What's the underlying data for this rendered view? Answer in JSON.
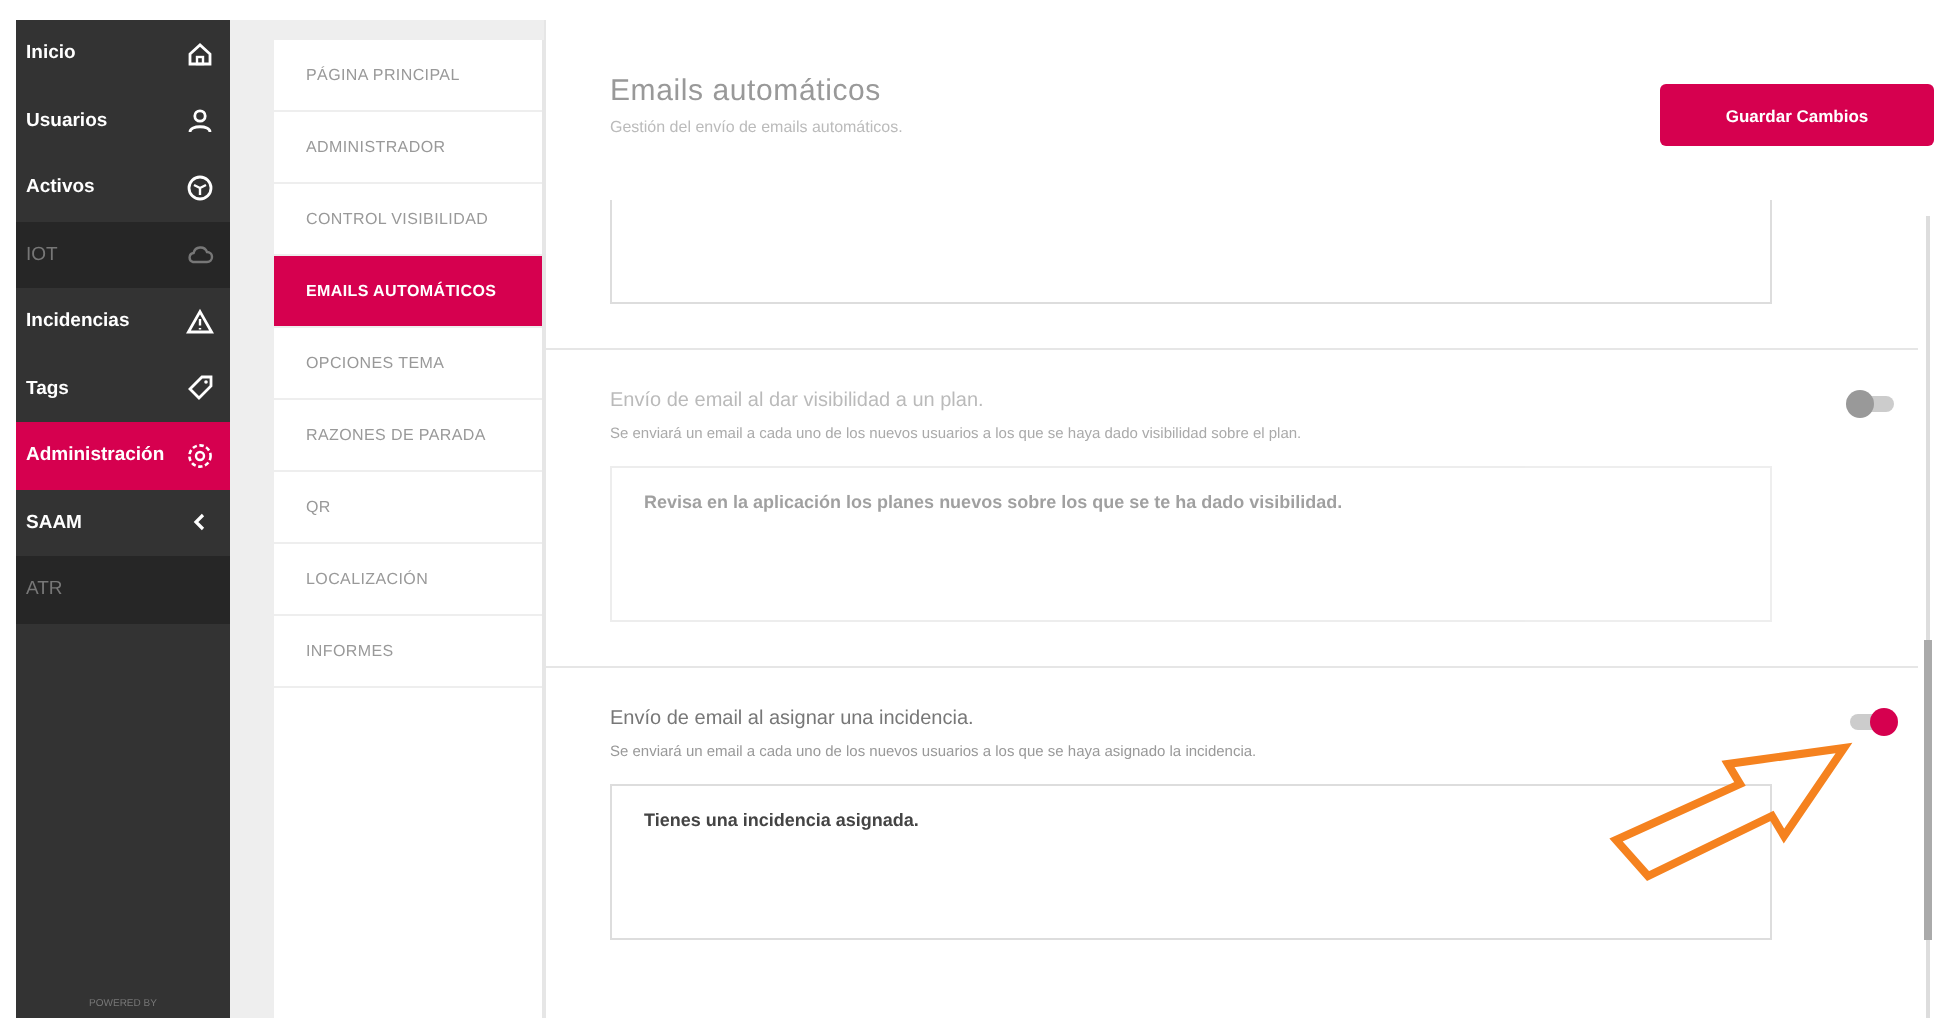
{
  "sidebar": {
    "items": [
      {
        "label": "Inicio",
        "selected": false,
        "disabled": false
      },
      {
        "label": "Usuarios",
        "selected": false,
        "disabled": false
      },
      {
        "label": "Activos",
        "selected": false,
        "disabled": false
      },
      {
        "label": "IOT",
        "selected": false,
        "disabled": true
      },
      {
        "label": "Incidencias",
        "selected": false,
        "disabled": false
      },
      {
        "label": "Tags",
        "selected": false,
        "disabled": false
      },
      {
        "label": "Administración",
        "selected": true,
        "disabled": false
      },
      {
        "label": "SAAM",
        "selected": false,
        "disabled": false
      },
      {
        "label": "ATR",
        "selected": false,
        "disabled": true
      }
    ],
    "footer": "POWERED BY"
  },
  "submenu": [
    {
      "label": "PÁGINA PRINCIPAL",
      "selected": false
    },
    {
      "label": "ADMINISTRADOR",
      "selected": false
    },
    {
      "label": "CONTROL VISIBILIDAD",
      "selected": false
    },
    {
      "label": "EMAILS AUTOMÁTICOS",
      "selected": true
    },
    {
      "label": "OPCIONES TEMA",
      "selected": false
    },
    {
      "label": "RAZONES DE PARADA",
      "selected": false
    },
    {
      "label": "QR",
      "selected": false
    },
    {
      "label": "LOCALIZACIÓN",
      "selected": false
    },
    {
      "label": "INFORMES",
      "selected": false
    }
  ],
  "header": {
    "title": "Emails automáticos",
    "subtitle": "Gestión del envío de emails automáticos.",
    "save_button": "Guardar Cambios"
  },
  "sections": [
    {
      "title": "Envío de email al dar visibilidad a un plan.",
      "description": "Se enviará un email a cada uno de los nuevos usuarios a los que se haya dado visibilidad sobre el plan.",
      "on": false,
      "message": "Revisa en la aplicación los planes nuevos sobre los que se te ha dado visibilidad."
    },
    {
      "title": "Envío de email al asignar una incidencia.",
      "description": "Se enviará un email a cada uno de los nuevos usuarios a los que se haya asignado la incidencia.",
      "on": true,
      "message": "Tienes una incidencia asignada."
    }
  ]
}
